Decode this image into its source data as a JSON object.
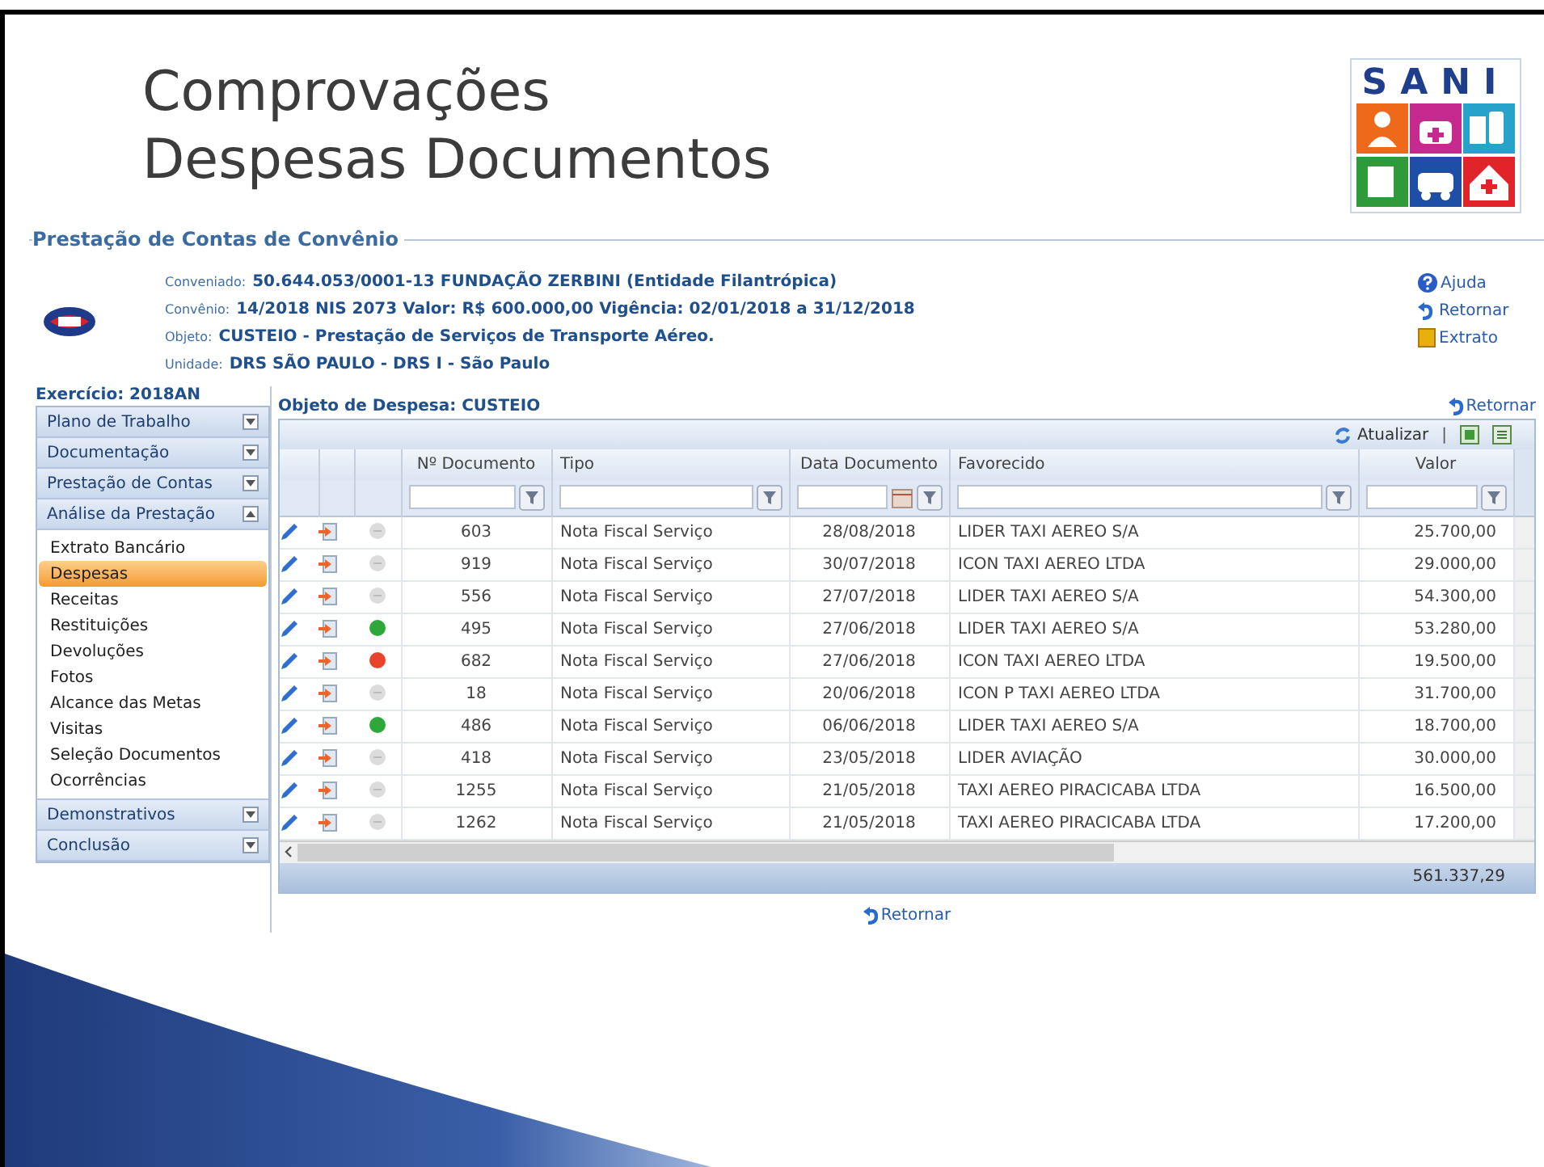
{
  "slide_title": [
    "Comprovações",
    "Despesas Documentos"
  ],
  "logo": {
    "text": "SANI"
  },
  "panel": {
    "legend": "Prestação de Contas de Convênio",
    "info": [
      {
        "label": "Conveniado:",
        "value": "50.644.053/0001-13  FUNDAÇÃO ZERBINI  (Entidade Filantrópica)"
      },
      {
        "label": "Convênio:",
        "value": "14/2018 NIS 2073 Valor: R$ 600.000,00 Vigência: 02/01/2018 a 31/12/2018"
      },
      {
        "label": "Objeto:",
        "value": "CUSTEIO - Prestação de Serviços de Transporte Aéreo."
      },
      {
        "label": "Unidade:",
        "value": "DRS SÃO PAULO - DRS I - São Paulo"
      }
    ],
    "links": [
      {
        "kind": "help",
        "label": "Ajuda"
      },
      {
        "kind": "back",
        "label": "Retornar"
      },
      {
        "kind": "statement",
        "label": "Extrato"
      }
    ]
  },
  "sidebar": {
    "header": "Exercício: 2018AN",
    "sections": [
      {
        "label": "Plano de Trabalho",
        "expanded": false
      },
      {
        "label": "Documentação",
        "expanded": false
      },
      {
        "label": "Prestação de Contas",
        "expanded": false
      },
      {
        "label": "Análise da Prestação",
        "expanded": true,
        "items": [
          {
            "label": "Extrato Bancário",
            "selected": false
          },
          {
            "label": "Despesas",
            "selected": true
          },
          {
            "label": "Receitas",
            "selected": false
          },
          {
            "label": "Restituições",
            "selected": false
          },
          {
            "label": "Devoluções",
            "selected": false
          },
          {
            "label": "Fotos",
            "selected": false
          },
          {
            "label": "Alcance das Metas",
            "selected": false
          },
          {
            "label": "Visitas",
            "selected": false
          },
          {
            "label": "Seleção Documentos",
            "selected": false
          },
          {
            "label": "Ocorrências",
            "selected": false
          }
        ]
      },
      {
        "label": "Demonstrativos",
        "expanded": false
      },
      {
        "label": "Conclusão",
        "expanded": false
      }
    ]
  },
  "main": {
    "title": "Objeto de Despesa: CUSTEIO",
    "top_link": "Retornar",
    "refresh": "Atualizar",
    "separator": "|",
    "table": {
      "columns": [
        "Nº Documento",
        "Tipo",
        "Data Documento",
        "Favorecido",
        "Valor"
      ],
      "rows": [
        {
          "doc": "603",
          "tipo": "Nota Fiscal Serviço",
          "data": "28/08/2018",
          "favorecido": "LIDER TAXI AEREO S/A",
          "valor": "25.700,00",
          "color": "#dcdcdc"
        },
        {
          "doc": "919",
          "tipo": "Nota Fiscal Serviço",
          "data": "30/07/2018",
          "favorecido": "ICON TAXI AEREO LTDA",
          "valor": "29.000,00",
          "color": "#dcdcdc"
        },
        {
          "doc": "556",
          "tipo": "Nota Fiscal Serviço",
          "data": "27/07/2018",
          "favorecido": "LIDER TAXI AEREO S/A",
          "valor": "54.300,00",
          "color": "#dcdcdc"
        },
        {
          "doc": "495",
          "tipo": "Nota Fiscal Serviço",
          "data": "27/06/2018",
          "favorecido": "LIDER TAXI AEREO S/A",
          "valor": "53.280,00",
          "color": "#2ea83a"
        },
        {
          "doc": "682",
          "tipo": "Nota Fiscal Serviço",
          "data": "27/06/2018",
          "favorecido": "ICON TAXI AEREO LTDA",
          "valor": "19.500,00",
          "color": "#e8442c"
        },
        {
          "doc": "18",
          "tipo": "Nota Fiscal Serviço",
          "data": "20/06/2018",
          "favorecido": "ICON P TAXI AEREO LTDA",
          "valor": "31.700,00",
          "color": "#dcdcdc"
        },
        {
          "doc": "486",
          "tipo": "Nota Fiscal Serviço",
          "data": "06/06/2018",
          "favorecido": "LIDER TAXI AEREO S/A",
          "valor": "18.700,00",
          "color": "#2ea83a"
        },
        {
          "doc": "418",
          "tipo": "Nota Fiscal Serviço",
          "data": "23/05/2018",
          "favorecido": "LIDER AVIAÇÃO",
          "valor": "30.000,00",
          "color": "#dcdcdc"
        },
        {
          "doc": "1255",
          "tipo": "Nota Fiscal Serviço",
          "data": "21/05/2018",
          "favorecido": "TAXI AEREO PIRACICABA LTDA",
          "valor": "16.500,00",
          "color": "#dcdcdc"
        },
        {
          "doc": "1262",
          "tipo": "Nota Fiscal Serviço",
          "data": "21/05/2018",
          "favorecido": "TAXI AEREO PIRACICABA LTDA",
          "valor": "17.200,00",
          "color": "#dcdcdc"
        }
      ],
      "total": "561.337,29"
    },
    "bottom_link": "Retornar"
  }
}
